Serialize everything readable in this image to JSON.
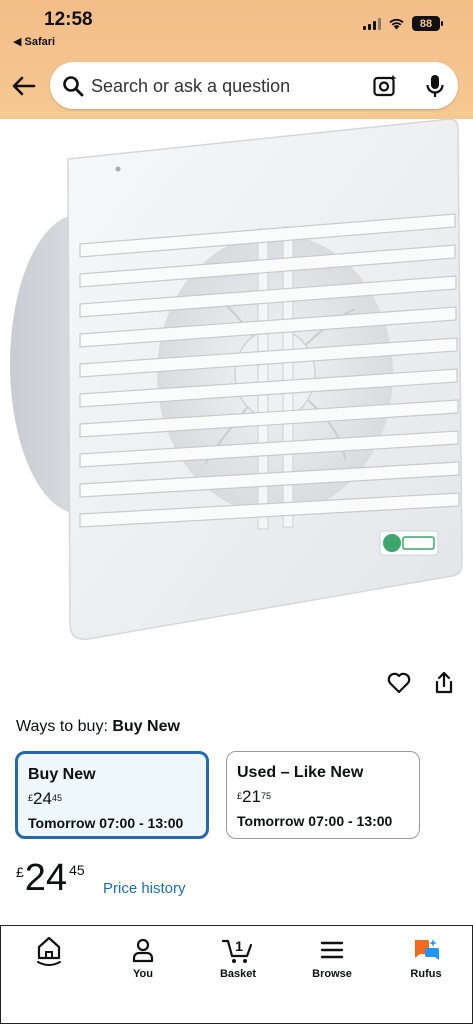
{
  "status_bar": {
    "time": "12:58",
    "back_app": "◀ Safari",
    "battery": "88"
  },
  "search": {
    "placeholder": "Search or ask a question"
  },
  "icons": {
    "back": "arrow-left-icon",
    "search": "search-icon",
    "camera": "camera-lens-icon",
    "mic": "microphone-icon",
    "heart": "heart-icon",
    "share": "share-icon"
  },
  "buying": {
    "ways_label": "Ways to buy:",
    "ways_value": "Buy New",
    "options": [
      {
        "title": "Buy New",
        "currency": "£",
        "whole": "24",
        "fraction": "45",
        "delivery": "Tomorrow 07:00 - 13:00"
      },
      {
        "title": "Used – Like New",
        "currency": "£",
        "whole": "21",
        "fraction": "75",
        "delivery": "Tomorrow 07:00 - 13:00"
      }
    ]
  },
  "price": {
    "currency": "£",
    "whole": "24",
    "fraction": "45",
    "history_link": "Price history"
  },
  "tabbar": {
    "items": [
      {
        "label": "",
        "icon": "home-icon"
      },
      {
        "label": "You",
        "icon": "person-icon"
      },
      {
        "label": "Basket",
        "icon": "cart-icon",
        "count": "1"
      },
      {
        "label": "Browse",
        "icon": "menu-icon"
      },
      {
        "label": "Rufus",
        "icon": "rufus-icon"
      }
    ]
  },
  "colors": {
    "header_bg": "#f6c892",
    "selected_border": "#2469a9",
    "selected_bg": "#edf7fc",
    "link": "#1f6fb6"
  }
}
